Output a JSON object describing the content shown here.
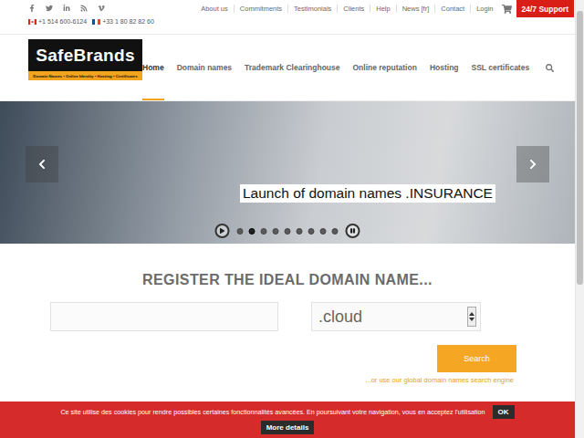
{
  "top_bar": {
    "phones": [
      "+1 514 600-6124",
      "+33 1 80 82 82 60"
    ],
    "links": [
      "About us",
      "Commitments",
      "Testimonials",
      "Clients",
      "Help",
      "News [fr]",
      "Contact",
      "Login"
    ],
    "support_button": "24/7 Support"
  },
  "logo": {
    "name": "SafeBrands",
    "tagline": "Domain Names • Online Identity • Hosting • Certificates"
  },
  "nav": [
    {
      "label": "Home",
      "selected": true
    },
    {
      "label": "Domain names",
      "selected": false
    },
    {
      "label": "Trademark Clearinghouse",
      "selected": false
    },
    {
      "label": "Online reputation",
      "selected": false
    },
    {
      "label": "Hosting",
      "selected": false
    },
    {
      "label": "SSL certificates",
      "selected": false
    }
  ],
  "slider": {
    "caption": "Launch of domain names .INSURANCE",
    "dots": [
      {
        "selected": false
      },
      {
        "selected": true
      },
      {
        "selected": false
      },
      {
        "selected": false
      },
      {
        "selected": false
      },
      {
        "selected": false
      },
      {
        "selected": false
      },
      {
        "selected": false
      },
      {
        "selected": false
      }
    ]
  },
  "domain_search": {
    "heading": "REGISTER THE IDEAL DOMAIN NAME...",
    "query": "",
    "extension": ".cloud",
    "button": "Search",
    "link": "...or use our global domain names search engine"
  },
  "cookie_bar": {
    "text": "Ce site utilise des cookies pour rendre possibles certaines fonctionnalités avancées. En poursuivant votre navigation, vous en acceptez l'utilisation",
    "ok": "OK",
    "more": "More details"
  }
}
